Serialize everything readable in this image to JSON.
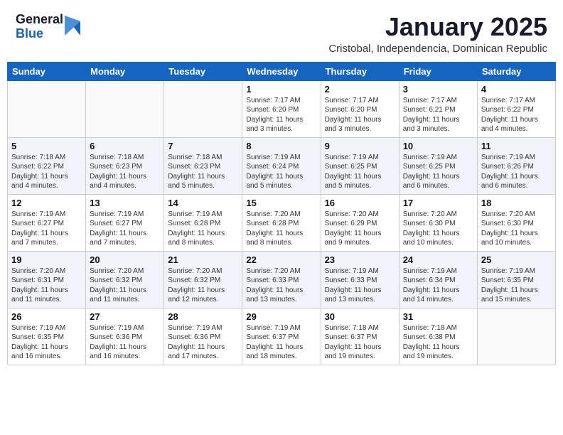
{
  "header": {
    "logo_general": "General",
    "logo_blue": "Blue",
    "month": "January 2025",
    "location": "Cristobal, Independencia, Dominican Republic"
  },
  "days": [
    "Sunday",
    "Monday",
    "Tuesday",
    "Wednesday",
    "Thursday",
    "Friday",
    "Saturday"
  ],
  "weeks": [
    [
      {
        "date": "",
        "info": ""
      },
      {
        "date": "",
        "info": ""
      },
      {
        "date": "",
        "info": ""
      },
      {
        "date": "1",
        "info": "Sunrise: 7:17 AM\nSunset: 6:20 PM\nDaylight: 11 hours\nand 3 minutes."
      },
      {
        "date": "2",
        "info": "Sunrise: 7:17 AM\nSunset: 6:20 PM\nDaylight: 11 hours\nand 3 minutes."
      },
      {
        "date": "3",
        "info": "Sunrise: 7:17 AM\nSunset: 6:21 PM\nDaylight: 11 hours\nand 3 minutes."
      },
      {
        "date": "4",
        "info": "Sunrise: 7:17 AM\nSunset: 6:22 PM\nDaylight: 11 hours\nand 4 minutes."
      }
    ],
    [
      {
        "date": "5",
        "info": "Sunrise: 7:18 AM\nSunset: 6:22 PM\nDaylight: 11 hours\nand 4 minutes."
      },
      {
        "date": "6",
        "info": "Sunrise: 7:18 AM\nSunset: 6:23 PM\nDaylight: 11 hours\nand 4 minutes."
      },
      {
        "date": "7",
        "info": "Sunrise: 7:18 AM\nSunset: 6:23 PM\nDaylight: 11 hours\nand 5 minutes."
      },
      {
        "date": "8",
        "info": "Sunrise: 7:19 AM\nSunset: 6:24 PM\nDaylight: 11 hours\nand 5 minutes."
      },
      {
        "date": "9",
        "info": "Sunrise: 7:19 AM\nSunset: 6:25 PM\nDaylight: 11 hours\nand 5 minutes."
      },
      {
        "date": "10",
        "info": "Sunrise: 7:19 AM\nSunset: 6:25 PM\nDaylight: 11 hours\nand 6 minutes."
      },
      {
        "date": "11",
        "info": "Sunrise: 7:19 AM\nSunset: 6:26 PM\nDaylight: 11 hours\nand 6 minutes."
      }
    ],
    [
      {
        "date": "12",
        "info": "Sunrise: 7:19 AM\nSunset: 6:27 PM\nDaylight: 11 hours\nand 7 minutes."
      },
      {
        "date": "13",
        "info": "Sunrise: 7:19 AM\nSunset: 6:27 PM\nDaylight: 11 hours\nand 7 minutes."
      },
      {
        "date": "14",
        "info": "Sunrise: 7:19 AM\nSunset: 6:28 PM\nDaylight: 11 hours\nand 8 minutes."
      },
      {
        "date": "15",
        "info": "Sunrise: 7:20 AM\nSunset: 6:28 PM\nDaylight: 11 hours\nand 8 minutes."
      },
      {
        "date": "16",
        "info": "Sunrise: 7:20 AM\nSunset: 6:29 PM\nDaylight: 11 hours\nand 9 minutes."
      },
      {
        "date": "17",
        "info": "Sunrise: 7:20 AM\nSunset: 6:30 PM\nDaylight: 11 hours\nand 10 minutes."
      },
      {
        "date": "18",
        "info": "Sunrise: 7:20 AM\nSunset: 6:30 PM\nDaylight: 11 hours\nand 10 minutes."
      }
    ],
    [
      {
        "date": "19",
        "info": "Sunrise: 7:20 AM\nSunset: 6:31 PM\nDaylight: 11 hours\nand 11 minutes."
      },
      {
        "date": "20",
        "info": "Sunrise: 7:20 AM\nSunset: 6:32 PM\nDaylight: 11 hours\nand 11 minutes."
      },
      {
        "date": "21",
        "info": "Sunrise: 7:20 AM\nSunset: 6:32 PM\nDaylight: 11 hours\nand 12 minutes."
      },
      {
        "date": "22",
        "info": "Sunrise: 7:20 AM\nSunset: 6:33 PM\nDaylight: 11 hours\nand 13 minutes."
      },
      {
        "date": "23",
        "info": "Sunrise: 7:19 AM\nSunset: 6:33 PM\nDaylight: 11 hours\nand 13 minutes."
      },
      {
        "date": "24",
        "info": "Sunrise: 7:19 AM\nSunset: 6:34 PM\nDaylight: 11 hours\nand 14 minutes."
      },
      {
        "date": "25",
        "info": "Sunrise: 7:19 AM\nSunset: 6:35 PM\nDaylight: 11 hours\nand 15 minutes."
      }
    ],
    [
      {
        "date": "26",
        "info": "Sunrise: 7:19 AM\nSunset: 6:35 PM\nDaylight: 11 hours\nand 16 minutes."
      },
      {
        "date": "27",
        "info": "Sunrise: 7:19 AM\nSunset: 6:36 PM\nDaylight: 11 hours\nand 16 minutes."
      },
      {
        "date": "28",
        "info": "Sunrise: 7:19 AM\nSunset: 6:36 PM\nDaylight: 11 hours\nand 17 minutes."
      },
      {
        "date": "29",
        "info": "Sunrise: 7:19 AM\nSunset: 6:37 PM\nDaylight: 11 hours\nand 18 minutes."
      },
      {
        "date": "30",
        "info": "Sunrise: 7:18 AM\nSunset: 6:37 PM\nDaylight: 11 hours\nand 19 minutes."
      },
      {
        "date": "31",
        "info": "Sunrise: 7:18 AM\nSunset: 6:38 PM\nDaylight: 11 hours\nand 19 minutes."
      },
      {
        "date": "",
        "info": ""
      }
    ]
  ]
}
